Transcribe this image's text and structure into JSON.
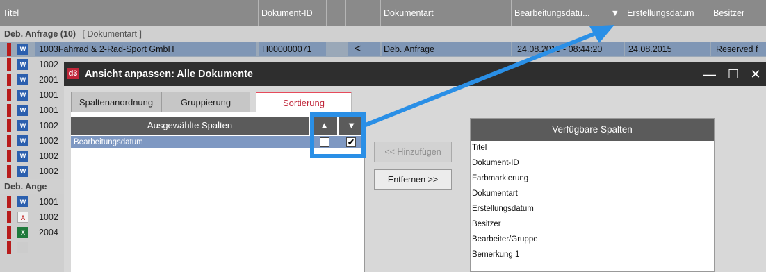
{
  "list": {
    "columns": [
      "Titel",
      "Dokument-ID",
      "",
      "",
      "Dokumentart",
      "Bearbeitungsdatu...",
      "Erstellungsdatum",
      "Besitzer"
    ],
    "sort_indicator": "▼",
    "groups": [
      {
        "label": "Deb. Anfrage (10)",
        "tag": "[ Dokumentart ]"
      },
      {
        "label": "Deb. Ange"
      }
    ],
    "selected_row": {
      "title": "1003Fahrrad & 2-Rad-Sport GmbH",
      "doc_id": "H000000071",
      "doctype": "Deb. Anfrage",
      "edited": "24.08.2015 - 08:44:20",
      "created": "24.08.2015",
      "owner": "Reserved f"
    },
    "row_prefixes": [
      "1002",
      "2001",
      "1001",
      "1001",
      "1002",
      "1002",
      "1002",
      "1002"
    ],
    "row_prefixes_group2": [
      "1001",
      "1002",
      "2004"
    ]
  },
  "dialog": {
    "badge": "d3",
    "title": "Ansicht anpassen: Alle Dokumente",
    "tabs": [
      "Spaltenanordnung",
      "Gruppierung",
      "Sortierung"
    ],
    "selected_header": "Ausgewählte Spalten",
    "up_arrow": "▲",
    "down_arrow": "▼",
    "selected_item": "Bearbeitungsdatum",
    "asc_checked": false,
    "desc_checked": true,
    "add_button": "<< Hinzufügen",
    "remove_button": "Entfernen >>",
    "available_header": "Verfügbare Spalten",
    "available_items": [
      "Titel",
      "Dokument-ID",
      "Farbmarkierung",
      "Dokumentart",
      "Erstellungsdatum",
      "Besitzer",
      "Bearbeiter/Gruppe",
      "Bemerkung 1"
    ],
    "window_buttons": [
      "minimize-icon",
      "maximize-icon",
      "close-icon"
    ]
  },
  "colors": {
    "accent": "#c0273a",
    "highlight": "#2a8fe6",
    "selection": "#7e98c2"
  }
}
